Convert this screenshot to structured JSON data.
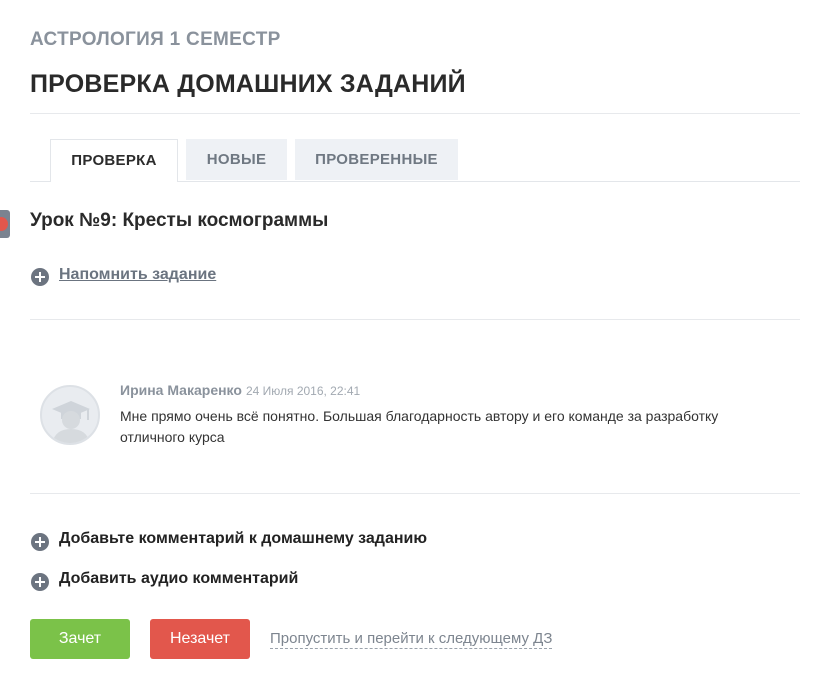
{
  "header": {
    "course": "АСТРОЛОГИЯ 1 СЕМЕСТР",
    "title": "ПРОВЕРКА ДОМАШНИХ ЗАДАНИЙ"
  },
  "tabs": [
    {
      "label": "ПРОВЕРКА",
      "active": true
    },
    {
      "label": "НОВЫЕ",
      "active": false
    },
    {
      "label": "ПРОВЕРЕННЫЕ",
      "active": false
    }
  ],
  "lesson": {
    "title": "Урок №9: Кресты космограммы",
    "remind_link": "Напомнить задание"
  },
  "comment": {
    "author": "Ирина Макаренко",
    "date": "24 Июля 2016, 22:41",
    "text": "Мне прямо очень всё понятно. Большая благодарность автору и его команде за разработку отличного курса"
  },
  "actions": {
    "add_comment": "Добавьте комментарий к домашнему заданию",
    "add_audio": "Добавить аудио комментарий"
  },
  "buttons": {
    "pass": "Зачет",
    "fail": "Незачет",
    "skip": "Пропустить и перейти к следующему ДЗ"
  },
  "colors": {
    "pass": "#7bc249",
    "fail": "#e2574c",
    "muted_text": "#8a929c"
  }
}
